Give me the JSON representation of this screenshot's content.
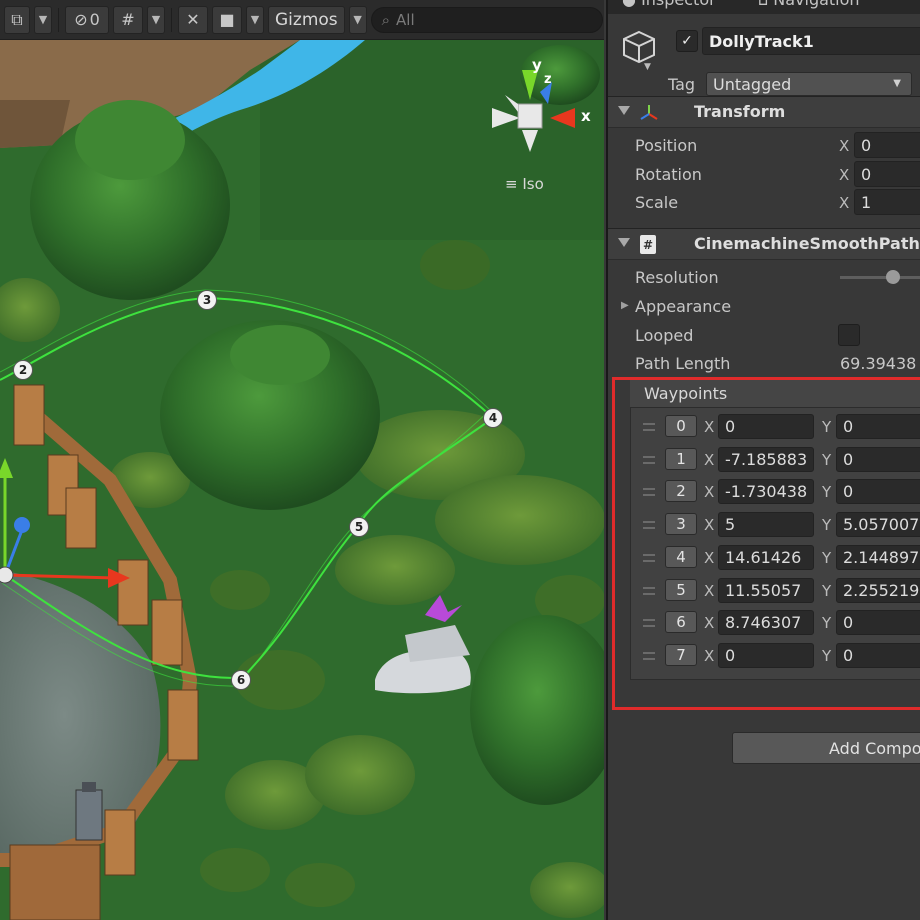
{
  "scene_toolbar": {
    "hidden_count": "0",
    "gizmos_label": "Gizmos",
    "search_placeholder": "All",
    "icons": [
      "draw-mode-icon",
      "visibility-icon",
      "grid-icon",
      "tools-icon",
      "camera-icon",
      "search-icon"
    ]
  },
  "scene": {
    "orientation_gizmo": {
      "x_label": "x",
      "y_label": "y",
      "z_label": "z",
      "projection_label": "Iso"
    },
    "waypoint_labels": [
      "2",
      "3",
      "4",
      "5",
      "6"
    ],
    "colors": {
      "path": "#3ee23e",
      "axis_x": "#e8371e",
      "axis_y": "#79d72a",
      "axis_z": "#3a7ee8"
    }
  },
  "inspector": {
    "tabs": [
      "Inspector",
      "Navigation"
    ],
    "object": {
      "active": true,
      "name": "DollyTrack1",
      "tag_label": "Tag",
      "tag_value": "Untagged"
    },
    "transform": {
      "title": "Transform",
      "rows": [
        {
          "label": "Position",
          "axis": "X",
          "value": "0"
        },
        {
          "label": "Rotation",
          "axis": "X",
          "value": "0"
        },
        {
          "label": "Scale",
          "axis": "X",
          "value": "1"
        }
      ]
    },
    "smooth_path": {
      "title": "CinemachineSmoothPath",
      "resolution_label": "Resolution",
      "appearance_label": "Appearance",
      "looped_label": "Looped",
      "looped": false,
      "path_length_label": "Path Length",
      "path_length_value": "69.39438",
      "waypoints_label": "Waypoints",
      "waypoints": [
        {
          "index": "0",
          "x": "0",
          "y": "0"
        },
        {
          "index": "1",
          "x": "-7.185883",
          "y": "0"
        },
        {
          "index": "2",
          "x": "-1.730438",
          "y": "0"
        },
        {
          "index": "3",
          "x": "5",
          "y": "5.057007"
        },
        {
          "index": "4",
          "x": "14.61426",
          "y": "2.144897"
        },
        {
          "index": "5",
          "x": "11.55057",
          "y": "2.255219"
        },
        {
          "index": "6",
          "x": "8.746307",
          "y": "0"
        },
        {
          "index": "7",
          "x": "0",
          "y": "0"
        }
      ],
      "highlight_color": "#e02b2b"
    },
    "add_component_label": "Add Component"
  }
}
